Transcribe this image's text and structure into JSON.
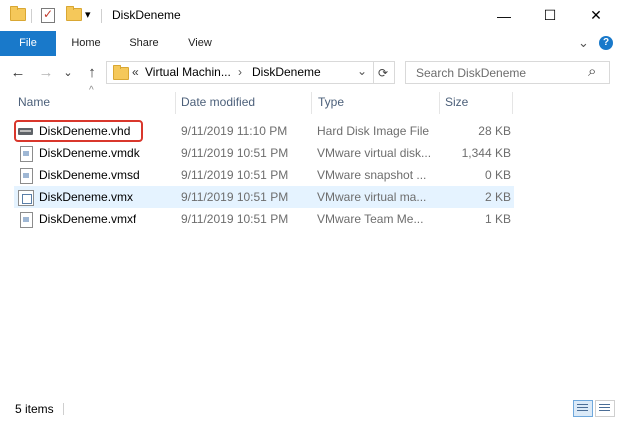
{
  "window": {
    "title": "DiskDeneme",
    "minimize_glyph": "—",
    "maximize_glyph": "☐",
    "close_glyph": "✕"
  },
  "quick_access": {
    "dropdown_glyph": "▾"
  },
  "ribbon": {
    "tabs": [
      {
        "label": "File",
        "active": true
      },
      {
        "label": "Home"
      },
      {
        "label": "Share"
      },
      {
        "label": "View"
      }
    ],
    "expand_glyph": "⌄",
    "help_glyph": "?"
  },
  "nav": {
    "back_glyph": "←",
    "forward_glyph": "→",
    "recent_glyph": "⌄",
    "up_glyph": "↑"
  },
  "address": {
    "overflow": "«",
    "crumbs": [
      "Virtual Machin...",
      "DiskDeneme"
    ],
    "separator": "›",
    "dropdown_glyph": "⌄",
    "refresh_glyph": "⟳"
  },
  "search": {
    "placeholder": "Search DiskDeneme",
    "icon_glyph": "⌕"
  },
  "columns": {
    "sort_glyph": "^",
    "name": "Name",
    "date": "Date modified",
    "type": "Type",
    "size": "Size"
  },
  "files": [
    {
      "name": "DiskDeneme.vhd",
      "date": "9/11/2019 11:10 PM",
      "type": "Hard Disk Image File",
      "size": "28 KB",
      "icon": "hard-disk-icon"
    },
    {
      "name": "DiskDeneme.vmdk",
      "date": "9/11/2019 10:51 PM",
      "type": "VMware virtual disk...",
      "size": "1,344 KB",
      "icon": "file-icon"
    },
    {
      "name": "DiskDeneme.vmsd",
      "date": "9/11/2019 10:51 PM",
      "type": "VMware snapshot ...",
      "size": "0 KB",
      "icon": "file-icon"
    },
    {
      "name": "DiskDeneme.vmx",
      "date": "9/11/2019 10:51 PM",
      "type": "VMware virtual ma...",
      "size": "2 KB",
      "icon": "vm-config-icon",
      "selected": true
    },
    {
      "name": "DiskDeneme.vmxf",
      "date": "9/11/2019 10:51 PM",
      "type": "VMware Team Me...",
      "size": "1 KB",
      "icon": "file-icon"
    }
  ],
  "status": {
    "item_count": "5 items"
  },
  "colors": {
    "accent": "#1979ca",
    "selection": "#e5f3ff",
    "highlight": "#d9372c",
    "header_text": "#4c607a"
  }
}
